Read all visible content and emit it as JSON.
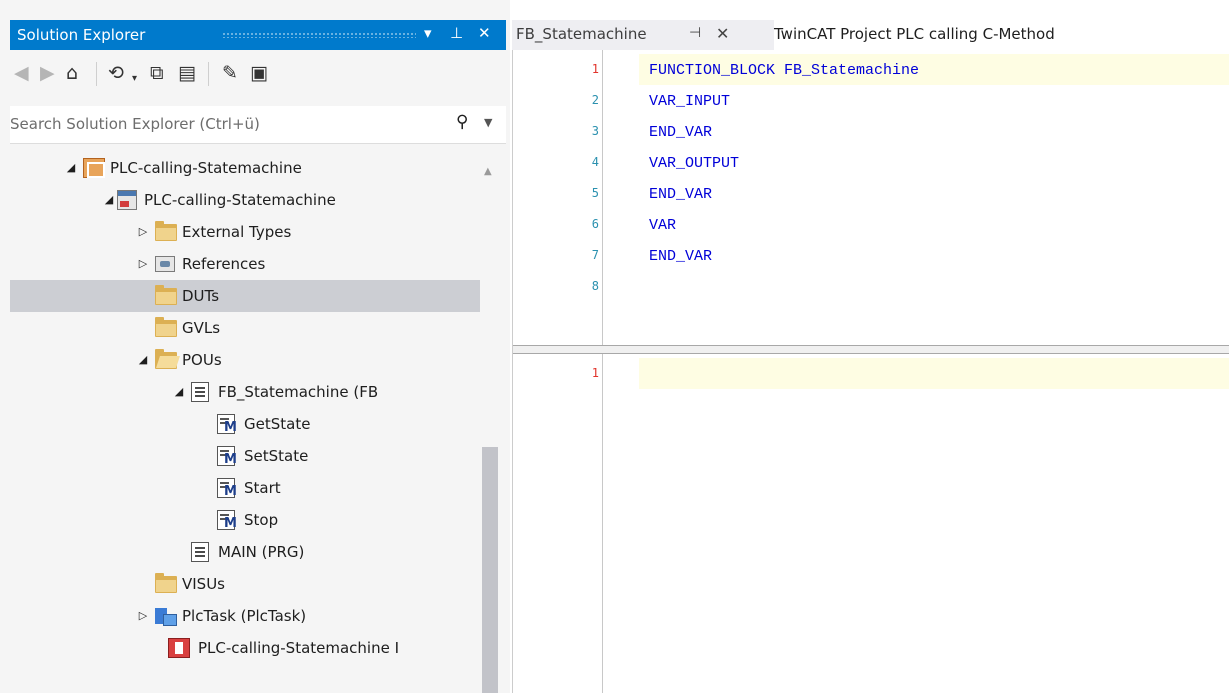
{
  "solution_explorer": {
    "title": "Solution Explorer",
    "title_buttons": {
      "dropdown": "▾",
      "pin": "⊥",
      "close": "✕"
    },
    "search_placeholder": "Search Solution Explorer (Ctrl+ü)",
    "tree": [
      {
        "label": "PLC-calling-Statemachine",
        "icon": "plc-project-icon",
        "expander": "◢",
        "depth": 0
      },
      {
        "label": "PLC-calling-Statemachine",
        "icon": "plc-object-icon",
        "expander": "◢",
        "depth": 1
      },
      {
        "label": "External Types",
        "icon": "folder-icon",
        "expander": "▷",
        "depth": 2
      },
      {
        "label": "References",
        "icon": "references-icon",
        "expander": "▷",
        "depth": 2
      },
      {
        "label": "DUTs",
        "icon": "folder-icon",
        "expander": "",
        "depth": 2,
        "selected": true
      },
      {
        "label": "GVLs",
        "icon": "folder-icon",
        "expander": "",
        "depth": 2
      },
      {
        "label": "POUs",
        "icon": "folder-open-icon",
        "expander": "◢",
        "depth": 2
      },
      {
        "label": "FB_Statemachine (FB",
        "icon": "pou-icon",
        "expander": "◢",
        "depth": 3
      },
      {
        "label": "GetState",
        "icon": "method-icon",
        "expander": "",
        "depth": 4
      },
      {
        "label": "SetState",
        "icon": "method-icon",
        "expander": "",
        "depth": 4
      },
      {
        "label": "Start",
        "icon": "method-icon",
        "expander": "",
        "depth": 4
      },
      {
        "label": "Stop",
        "icon": "method-icon",
        "expander": "",
        "depth": 4
      },
      {
        "label": "MAIN (PRG)",
        "icon": "pou-icon",
        "expander": "",
        "depth": 3
      },
      {
        "label": "VISUs",
        "icon": "folder-icon",
        "expander": "",
        "depth": 2
      },
      {
        "label": "PlcTask (PlcTask)",
        "icon": "task-icon",
        "expander": "▷",
        "depth": 2
      },
      {
        "label": "PLC-calling-Statemachine I",
        "icon": "instance-icon",
        "expander": "",
        "depth": 1
      }
    ]
  },
  "tabs": [
    {
      "label": "FB_Statemachine",
      "pin": "⊣",
      "close": "✕",
      "active": true
    },
    {
      "label": "TwinCAT Project PLC calling C-Method",
      "active": false
    }
  ],
  "editor": {
    "declaration_lines": [
      "FUNCTION_BLOCK FB_Statemachine",
      "VAR_INPUT",
      "END_VAR",
      "VAR_OUTPUT",
      "END_VAR",
      "VAR",
      "END_VAR",
      ""
    ],
    "body_lines": [
      ""
    ]
  },
  "colors": {
    "accent": "#007acc",
    "selection": "#ccced3",
    "keyword": "#0000d8",
    "line_number": "#2b91af",
    "current_line_number": "#e2342c",
    "current_line_bg": "#fefde3"
  }
}
